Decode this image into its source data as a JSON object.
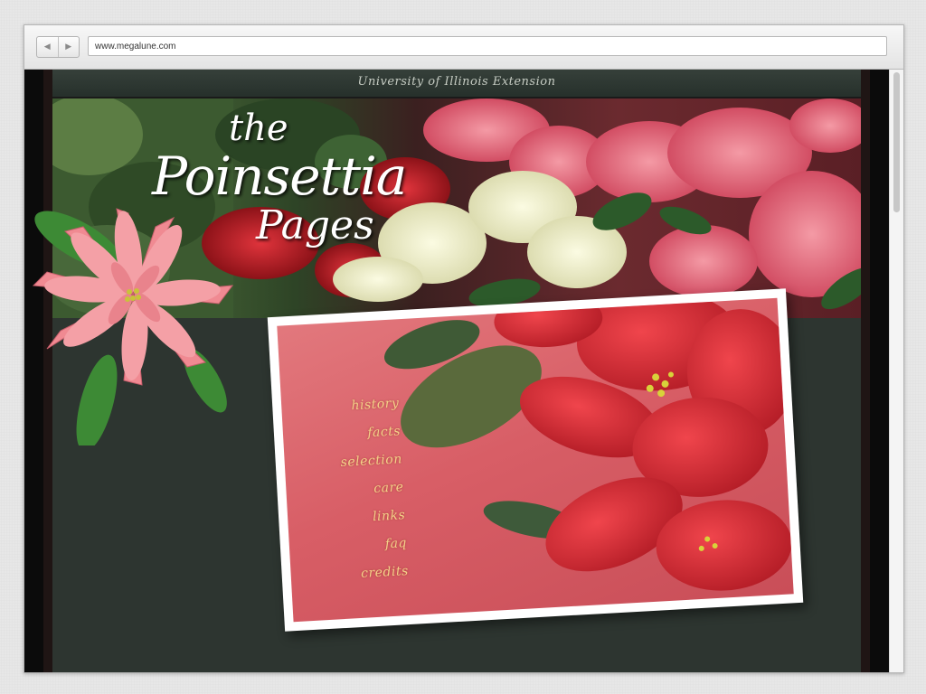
{
  "browser": {
    "url": "www.megalune.com",
    "back_icon": "◀",
    "forward_icon": "▶"
  },
  "site": {
    "header_text": "University of Illinois Extension",
    "logo": {
      "line1": "the",
      "line2": "Poinsettia",
      "line3": "Pages"
    },
    "menu": [
      {
        "label": "history"
      },
      {
        "label": "facts"
      },
      {
        "label": "selection"
      },
      {
        "label": "care"
      },
      {
        "label": "links"
      },
      {
        "label": "faq"
      },
      {
        "label": "credits"
      }
    ]
  },
  "colors": {
    "menu_text": "#f4d189",
    "page_bg": "#2d3530",
    "photo_bg": "#d85e66"
  }
}
